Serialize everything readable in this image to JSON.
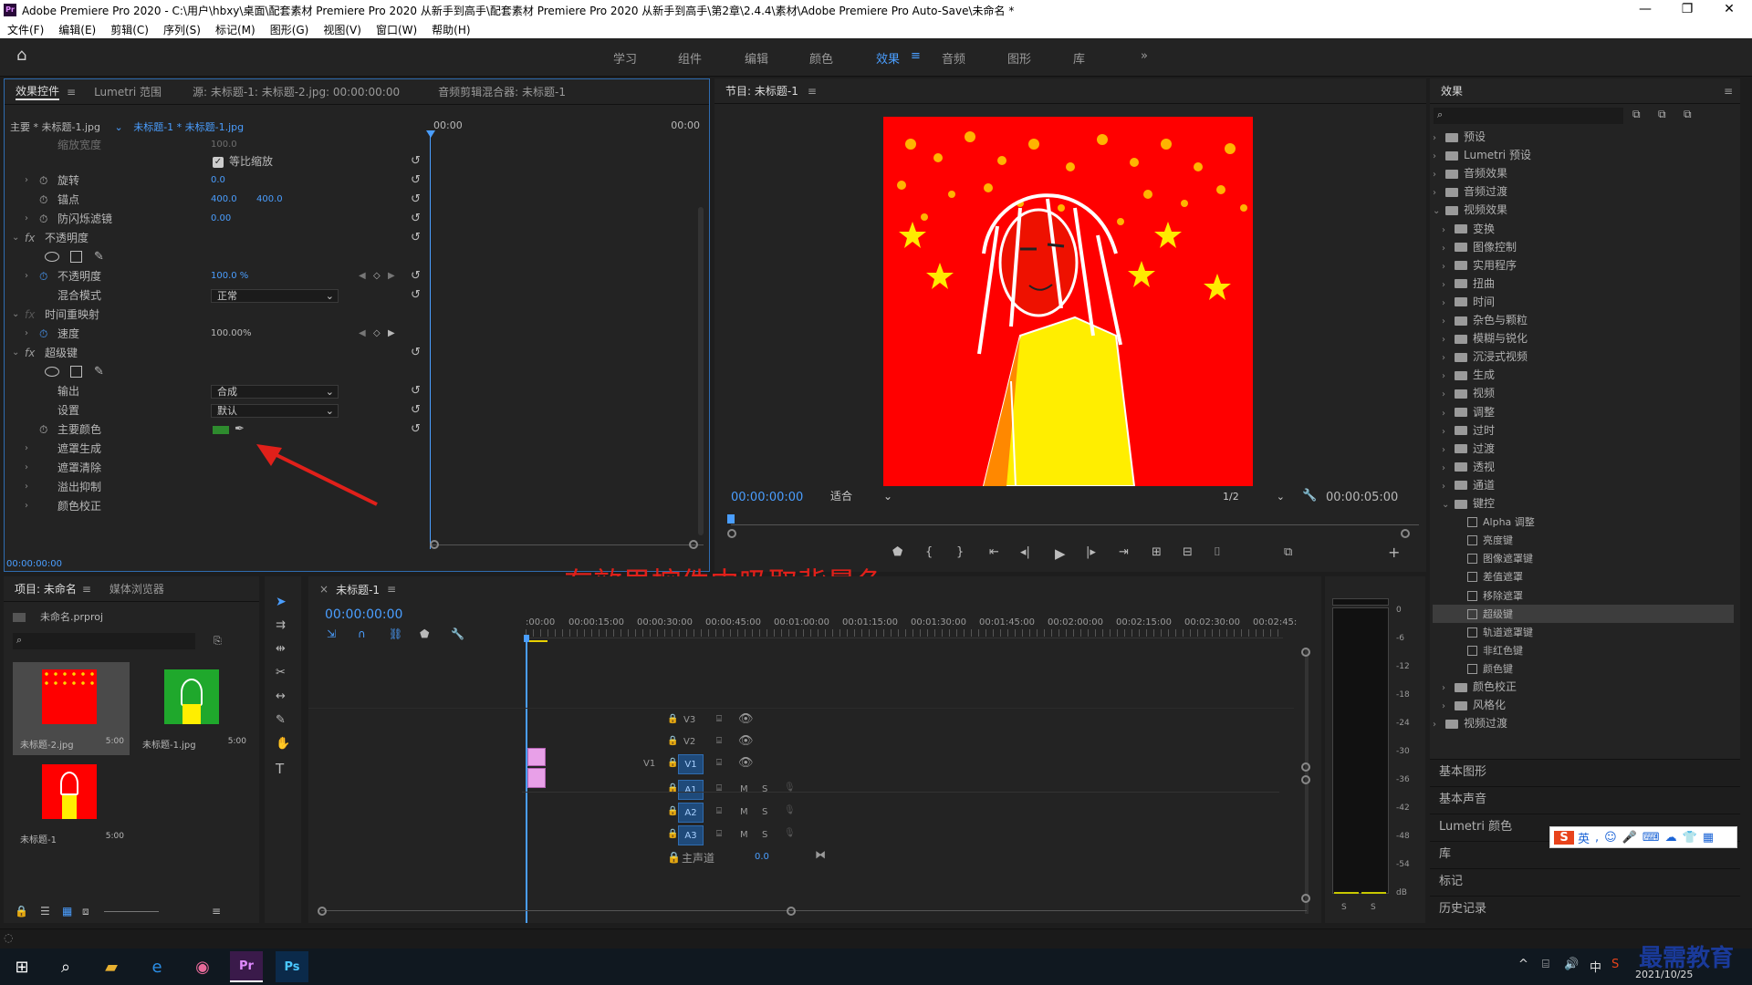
{
  "window": {
    "title": "Adobe Premiere Pro 2020 - C:\\用户\\hbxy\\桌面\\配套素材 Premiere Pro 2020 从新手到高手\\配套素材 Premiere Pro 2020 从新手到高手\\第2章\\2.4.4\\素材\\Adobe Premiere Pro Auto-Save\\未命名 *",
    "logo": "Pr"
  },
  "menu": [
    "文件(F)",
    "编辑(E)",
    "剪辑(C)",
    "序列(S)",
    "标记(M)",
    "图形(G)",
    "视图(V)",
    "窗口(W)",
    "帮助(H)"
  ],
  "workspaces": [
    "学习",
    "组件",
    "编辑",
    "颜色",
    "效果",
    "音频",
    "图形",
    "库"
  ],
  "active_workspace": "效果",
  "effect_controls": {
    "tabs": [
      "效果控件",
      "Lumetri 范围",
      "源: 未标题-1: 未标题-2.jpg: 00:00:00:00",
      "音频剪辑混合器: 未标题-1"
    ],
    "master": "主要 * 未标题-1.jpg",
    "clip": "未标题-1 * 未标题-1.jpg",
    "ruler_start": "00:00",
    "ruler_end": "00:00",
    "rows": {
      "scale_w": "缩放宽度",
      "scale_w_val": "100.0",
      "uniform": "等比缩放",
      "rotation": "旋转",
      "rotation_val": "0.0",
      "anchor": "锚点",
      "anchor_x": "400.0",
      "anchor_y": "400.0",
      "flicker": "防闪烁滤镜",
      "flicker_val": "0.00",
      "opacity_group": "不透明度",
      "opacity": "不透明度",
      "opacity_val": "100.0 %",
      "blend": "混合模式",
      "blend_val": "正常",
      "time_remap": "时间重映射",
      "speed": "速度",
      "speed_val": "100.00%",
      "ultra_key": "超级键",
      "output": "输出",
      "output_val": "合成",
      "setting": "设置",
      "setting_val": "默认",
      "key_color": "主要颜色",
      "matte_gen": "遮罩生成",
      "matte_clean": "遮罩清除",
      "spill": "溢出抑制",
      "color_corr": "颜色校正"
    },
    "timecode": "00:00:00:00"
  },
  "program": {
    "title": "节目: 未标题-1",
    "timecode": "00:00:00:00",
    "fit": "适合",
    "res": "1/2",
    "duration": "00:00:05:00"
  },
  "annotation": "在效果控件中吸取背景色",
  "project": {
    "tabs": [
      "项目: 未命名",
      "媒体浏览器"
    ],
    "file": "未命名.prproj",
    "items": [
      {
        "name": "未标题-2.jpg",
        "dur": "5:00"
      },
      {
        "name": "未标题-1.jpg",
        "dur": "5:00"
      },
      {
        "name": "未标题-1",
        "dur": "5:00"
      }
    ]
  },
  "timeline": {
    "tab": "未标题-1",
    "timecode": "00:00:00:00",
    "ruler": [
      ":00:00",
      "00:00:15:00",
      "00:00:30:00",
      "00:00:45:00",
      "00:01:00:00",
      "00:01:15:00",
      "00:01:30:00",
      "00:01:45:00",
      "00:02:00:00",
      "00:02:15:00",
      "00:02:30:00",
      "00:02:45:"
    ],
    "tracks": [
      "V3",
      "V2",
      "V1",
      "A1",
      "A2",
      "A3"
    ],
    "master": "主声道",
    "master_val": "0.0",
    "src_v1": "V1",
    "m": "M",
    "s": "S"
  },
  "meters": [
    "0",
    "-6",
    "-12",
    "-18",
    "-24",
    "-30",
    "-36",
    "-42",
    "-48",
    "-54",
    "dB"
  ],
  "meter_solo": [
    "S",
    "S"
  ],
  "effects": {
    "title": "效果",
    "tree": [
      {
        "label": "预设",
        "type": "folder",
        "depth": 0
      },
      {
        "label": "Lumetri 预设",
        "type": "folder",
        "depth": 0
      },
      {
        "label": "音频效果",
        "type": "folder",
        "depth": 0
      },
      {
        "label": "音频过渡",
        "type": "folder",
        "depth": 0
      },
      {
        "label": "视频效果",
        "type": "folder",
        "depth": 0,
        "open": true
      },
      {
        "label": "变换",
        "type": "folder",
        "depth": 1
      },
      {
        "label": "图像控制",
        "type": "folder",
        "depth": 1
      },
      {
        "label": "实用程序",
        "type": "folder",
        "depth": 1
      },
      {
        "label": "扭曲",
        "type": "folder",
        "depth": 1
      },
      {
        "label": "时间",
        "type": "folder",
        "depth": 1
      },
      {
        "label": "杂色与颗粒",
        "type": "folder",
        "depth": 1
      },
      {
        "label": "模糊与锐化",
        "type": "folder",
        "depth": 1
      },
      {
        "label": "沉浸式视频",
        "type": "folder",
        "depth": 1
      },
      {
        "label": "生成",
        "type": "folder",
        "depth": 1
      },
      {
        "label": "视频",
        "type": "folder",
        "depth": 1
      },
      {
        "label": "调整",
        "type": "folder",
        "depth": 1
      },
      {
        "label": "过时",
        "type": "folder",
        "depth": 1
      },
      {
        "label": "过渡",
        "type": "folder",
        "depth": 1
      },
      {
        "label": "透视",
        "type": "folder",
        "depth": 1
      },
      {
        "label": "通道",
        "type": "folder",
        "depth": 1
      },
      {
        "label": "键控",
        "type": "folder",
        "depth": 1,
        "open": true
      },
      {
        "label": "Alpha 调整",
        "type": "fx",
        "depth": 2
      },
      {
        "label": "亮度键",
        "type": "fx",
        "depth": 2
      },
      {
        "label": "图像遮罩键",
        "type": "fx",
        "depth": 2
      },
      {
        "label": "差值遮罩",
        "type": "fx",
        "depth": 2
      },
      {
        "label": "移除遮罩",
        "type": "fx",
        "depth": 2
      },
      {
        "label": "超级键",
        "type": "fx",
        "depth": 2,
        "selected": true
      },
      {
        "label": "轨道遮罩键",
        "type": "fx",
        "depth": 2
      },
      {
        "label": "非红色键",
        "type": "fx",
        "depth": 2
      },
      {
        "label": "颜色键",
        "type": "fx",
        "depth": 2
      },
      {
        "label": "颜色校正",
        "type": "folder",
        "depth": 1
      },
      {
        "label": "风格化",
        "type": "folder",
        "depth": 1
      },
      {
        "label": "视频过渡",
        "type": "folder",
        "depth": 0
      }
    ],
    "panels": [
      "基本图形",
      "基本声音",
      "Lumetri 颜色",
      "库",
      "标记",
      "历史记录"
    ]
  },
  "ime": {
    "logo": "S",
    "lang": "英"
  },
  "taskbar": {
    "date": "2021/10/25",
    "watermark": "最需教育"
  },
  "colors": {
    "accent": "#4a9eff",
    "key_green": "#2e8b2e",
    "canvas_red": "#ff0000",
    "annotation_red": "#e0201a"
  }
}
